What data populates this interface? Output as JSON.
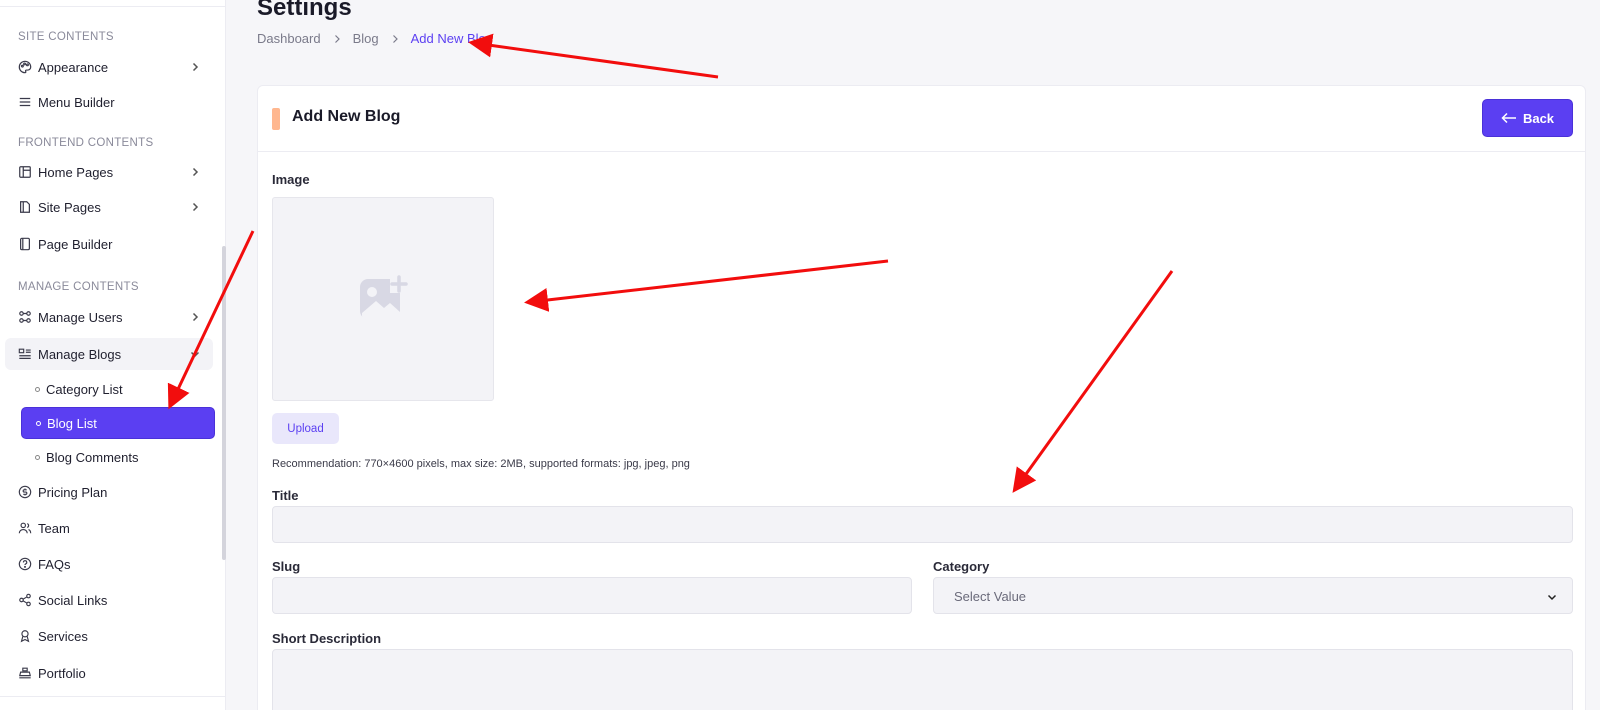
{
  "sidebar": {
    "sections": {
      "site": "SITE CONTENTS",
      "frontend": "FRONTEND CONTENTS",
      "manage": "MANAGE CONTENTS"
    },
    "items": {
      "appearance": "Appearance",
      "menu_builder": "Menu Builder",
      "home_pages": "Home Pages",
      "site_pages": "Site Pages",
      "page_builder": "Page Builder",
      "manage_users": "Manage Users",
      "manage_blogs": "Manage Blogs",
      "category_list": "Category List",
      "blog_list": "Blog List",
      "blog_comments": "Blog Comments",
      "pricing_plan": "Pricing Plan",
      "team": "Team",
      "faqs": "FAQs",
      "social_links": "Social Links",
      "services": "Services",
      "portfolio": "Portfolio"
    }
  },
  "header": {
    "title": "Settings",
    "breadcrumb": [
      "Dashboard",
      "Blog",
      "Add New Blog"
    ]
  },
  "card": {
    "title": "Add New Blog",
    "back_label": "Back"
  },
  "form": {
    "image_label": "Image",
    "upload_label": "Upload",
    "hint": "Recommendation: 770×4600 pixels, max size: 2MB, supported formats: jpg, jpeg, png",
    "title_label": "Title",
    "title_value": "",
    "slug_label": "Slug",
    "slug_value": "",
    "category_label": "Category",
    "category_selected": "Select Value",
    "short_desc_label": "Short Description",
    "short_desc_value": ""
  },
  "colors": {
    "accent": "#5b3ff2",
    "annotation": "#f20d0d",
    "card_marker": "#ffb78f"
  }
}
